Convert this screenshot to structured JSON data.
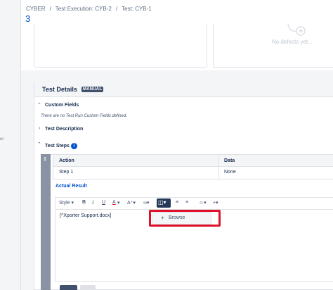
{
  "breadcrumb": {
    "project": "CYBER",
    "sep1": "/",
    "execution": "Test Execution: CYB-2",
    "sep2": "/",
    "test": "Test: CYB-1"
  },
  "issue_key_fragment": "3",
  "left_fragment": "ur",
  "defects": {
    "empty_text": "No defects yet..."
  },
  "test_details": {
    "title": "Test Details",
    "badge": "MANUAL",
    "custom_fields": {
      "title": "Custom Fields",
      "note": "There are no Test Run Custom Fields defined."
    },
    "description": {
      "title": "Test Description"
    },
    "steps": {
      "title": "Test Steps",
      "count": "1",
      "step_number": "1",
      "columns": [
        "Action",
        "Data"
      ],
      "rows": [
        [
          "Step 1",
          "None"
        ]
      ],
      "actual_result_label": "Actual Result"
    }
  },
  "editor": {
    "toolbar": {
      "style": "Style",
      "bold": "B",
      "italic": "I",
      "underline": "U",
      "color": "A",
      "attachment_icon": "attachment-icon",
      "plus": "+"
    },
    "content": "[^Xporter Support.docx]",
    "dropdown": {
      "plus": "+",
      "browse": "Browse"
    }
  },
  "colors": {
    "accent": "#0052cc",
    "highlight": "#e0102a",
    "header_bg": "#f4f5f7"
  }
}
